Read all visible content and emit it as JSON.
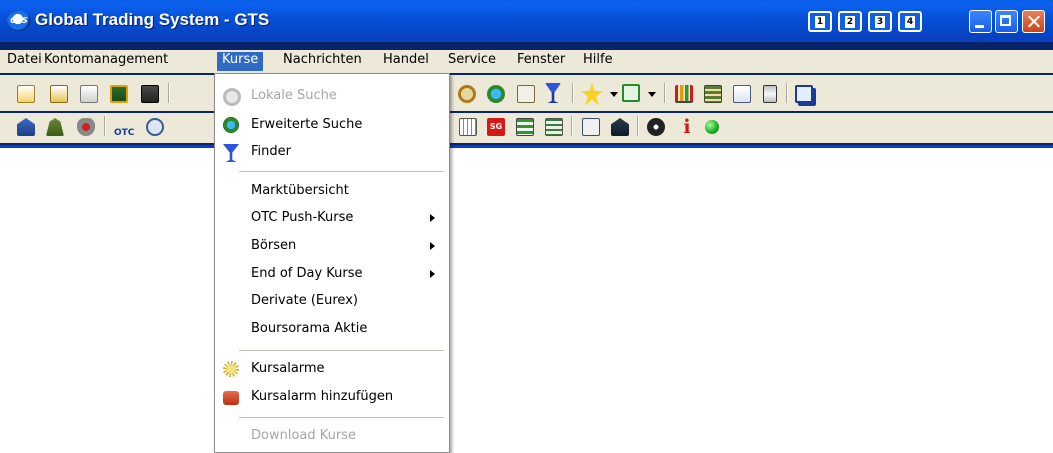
{
  "window": {
    "title": "Global Trading System - GTS",
    "logo_text": "GTS",
    "workspace_buttons": [
      "1",
      "2",
      "3",
      "4"
    ],
    "controls": [
      "minimize-icon",
      "maximize-icon",
      "close-icon"
    ]
  },
  "menubar": {
    "items": [
      "Datei",
      "Kontomanagement",
      "Kurse",
      "Nachrichten",
      "Handel",
      "Service",
      "Fenster",
      "Hilfe"
    ],
    "active": "Kurse"
  },
  "kurse_menu": {
    "items": [
      {
        "label": "Lokale Suche",
        "icon": "search-icon",
        "disabled": true
      },
      {
        "label": "Erweiterte Suche",
        "icon": "globe-search-icon",
        "disabled": false
      },
      {
        "label": "Finder",
        "icon": "cocktail-glass-icon",
        "disabled": false
      },
      {
        "label": "Marktübersicht",
        "icon": "",
        "disabled": false
      },
      {
        "label": "OTC Push-Kurse",
        "icon": "",
        "submenu": true,
        "disabled": false
      },
      {
        "label": "Börsen",
        "icon": "",
        "submenu": true,
        "disabled": false
      },
      {
        "label": "End of Day Kurse",
        "icon": "",
        "submenu": true,
        "disabled": false
      },
      {
        "label": "Derivate (Eurex)",
        "icon": "",
        "disabled": false
      },
      {
        "label": "Boursorama Aktie",
        "icon": "",
        "disabled": false
      },
      {
        "label": "Kursalarme",
        "icon": "alarm-icon",
        "disabled": false
      },
      {
        "label": "Kursalarm hinzufügen",
        "icon": "add-alarm-icon",
        "disabled": false
      },
      {
        "label": "Download Kurse",
        "icon": "",
        "disabled": true
      }
    ]
  },
  "toolbar1": {
    "icons": [
      "document-icon",
      "document-icon",
      "document-icon",
      "chart-window-icon",
      "window-icon",
      "search-icon",
      "globe-search-icon",
      "document-search-icon",
      "cocktail-glass-icon",
      "star-icon",
      "dropdown-arrow-icon",
      "window-stack-icon",
      "dropdown-arrow-icon",
      "bar-chart-icon",
      "table-icon",
      "document-icon",
      "hourglass-icon",
      "windows-cascade-icon"
    ]
  },
  "toolbar2": {
    "icons": [
      "bank-icon",
      "people-icon",
      "shield-icon",
      "otc-icon",
      "search-people-icon",
      "chart-icon",
      "sg-icon",
      "spreadsheet-icon",
      "list-icon",
      "data-icon",
      "bank-icon",
      "gear-icon",
      "info-icon",
      "status-light-icon"
    ],
    "otc_label": "OTC",
    "sg_label": "SG",
    "info_label": "i"
  },
  "colors": {
    "titlebar": "#0752d9",
    "menu_highlight": "#316ac5",
    "chrome": "#ece9d8",
    "status_green": "#1fb32a",
    "info_red": "#d11a1a"
  }
}
